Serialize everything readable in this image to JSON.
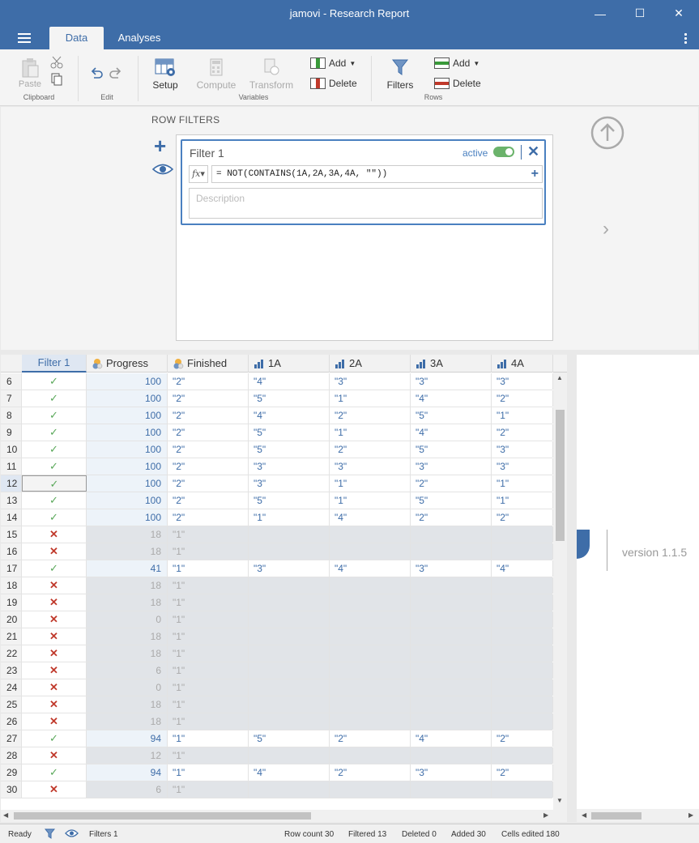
{
  "window": {
    "title": "jamovi - Research Report"
  },
  "tabs": {
    "data": "Data",
    "analyses": "Analyses"
  },
  "ribbon": {
    "paste": "Paste",
    "clipboard": "Clipboard",
    "edit": "Edit",
    "setup": "Setup",
    "compute": "Compute",
    "transform": "Transform",
    "variables": "Variables",
    "add_var": "Add",
    "delete_var": "Delete",
    "filters": "Filters",
    "add_row": "Add",
    "delete_row": "Delete",
    "rows": "Rows"
  },
  "filter_panel": {
    "title": "ROW FILTERS",
    "filter_name": "Filter 1",
    "active_label": "active",
    "formula": "= NOT(CONTAINS(1A,2A,3A,4A, \"\"))",
    "description_placeholder": "Description"
  },
  "grid": {
    "columns": [
      "Filter 1",
      "Progress",
      "Finished",
      "1A",
      "2A",
      "3A",
      "4A"
    ],
    "rows": [
      {
        "n": "6",
        "pass": true,
        "progress": "100",
        "finished": "\"2\"",
        "a1": "\"4\"",
        "a2": "\"3\"",
        "a3": "\"3\"",
        "a4": "\"3\""
      },
      {
        "n": "7",
        "pass": true,
        "progress": "100",
        "finished": "\"2\"",
        "a1": "\"5\"",
        "a2": "\"1\"",
        "a3": "\"4\"",
        "a4": "\"2\""
      },
      {
        "n": "8",
        "pass": true,
        "progress": "100",
        "finished": "\"2\"",
        "a1": "\"4\"",
        "a2": "\"2\"",
        "a3": "\"5\"",
        "a4": "\"1\""
      },
      {
        "n": "9",
        "pass": true,
        "progress": "100",
        "finished": "\"2\"",
        "a1": "\"5\"",
        "a2": "\"1\"",
        "a3": "\"4\"",
        "a4": "\"2\""
      },
      {
        "n": "10",
        "pass": true,
        "progress": "100",
        "finished": "\"2\"",
        "a1": "\"5\"",
        "a2": "\"2\"",
        "a3": "\"5\"",
        "a4": "\"3\""
      },
      {
        "n": "11",
        "pass": true,
        "progress": "100",
        "finished": "\"2\"",
        "a1": "\"3\"",
        "a2": "\"3\"",
        "a3": "\"3\"",
        "a4": "\"3\""
      },
      {
        "n": "12",
        "pass": true,
        "progress": "100",
        "finished": "\"2\"",
        "a1": "\"3\"",
        "a2": "\"1\"",
        "a3": "\"2\"",
        "a4": "\"1\"",
        "selected": true
      },
      {
        "n": "13",
        "pass": true,
        "progress": "100",
        "finished": "\"2\"",
        "a1": "\"5\"",
        "a2": "\"1\"",
        "a3": "\"5\"",
        "a4": "\"1\""
      },
      {
        "n": "14",
        "pass": true,
        "progress": "100",
        "finished": "\"2\"",
        "a1": "\"1\"",
        "a2": "\"4\"",
        "a3": "\"2\"",
        "a4": "\"2\""
      },
      {
        "n": "15",
        "pass": false,
        "progress": "18",
        "finished": "\"1\"",
        "a1": "",
        "a2": "",
        "a3": "",
        "a4": ""
      },
      {
        "n": "16",
        "pass": false,
        "progress": "18",
        "finished": "\"1\"",
        "a1": "",
        "a2": "",
        "a3": "",
        "a4": ""
      },
      {
        "n": "17",
        "pass": true,
        "progress": "41",
        "finished": "\"1\"",
        "a1": "\"3\"",
        "a2": "\"4\"",
        "a3": "\"3\"",
        "a4": "\"4\""
      },
      {
        "n": "18",
        "pass": false,
        "progress": "18",
        "finished": "\"1\"",
        "a1": "",
        "a2": "",
        "a3": "",
        "a4": ""
      },
      {
        "n": "19",
        "pass": false,
        "progress": "18",
        "finished": "\"1\"",
        "a1": "",
        "a2": "",
        "a3": "",
        "a4": ""
      },
      {
        "n": "20",
        "pass": false,
        "progress": "0",
        "finished": "\"1\"",
        "a1": "",
        "a2": "",
        "a3": "",
        "a4": ""
      },
      {
        "n": "21",
        "pass": false,
        "progress": "18",
        "finished": "\"1\"",
        "a1": "",
        "a2": "",
        "a3": "",
        "a4": ""
      },
      {
        "n": "22",
        "pass": false,
        "progress": "18",
        "finished": "\"1\"",
        "a1": "",
        "a2": "",
        "a3": "",
        "a4": ""
      },
      {
        "n": "23",
        "pass": false,
        "progress": "6",
        "finished": "\"1\"",
        "a1": "",
        "a2": "",
        "a3": "",
        "a4": ""
      },
      {
        "n": "24",
        "pass": false,
        "progress": "0",
        "finished": "\"1\"",
        "a1": "",
        "a2": "",
        "a3": "",
        "a4": ""
      },
      {
        "n": "25",
        "pass": false,
        "progress": "18",
        "finished": "\"1\"",
        "a1": "",
        "a2": "",
        "a3": "",
        "a4": ""
      },
      {
        "n": "26",
        "pass": false,
        "progress": "18",
        "finished": "\"1\"",
        "a1": "",
        "a2": "",
        "a3": "",
        "a4": ""
      },
      {
        "n": "27",
        "pass": true,
        "progress": "94",
        "finished": "\"1\"",
        "a1": "\"5\"",
        "a2": "\"2\"",
        "a3": "\"4\"",
        "a4": "\"2\""
      },
      {
        "n": "28",
        "pass": false,
        "progress": "12",
        "finished": "\"1\"",
        "a1": "",
        "a2": "",
        "a3": "",
        "a4": ""
      },
      {
        "n": "29",
        "pass": true,
        "progress": "94",
        "finished": "\"1\"",
        "a1": "\"4\"",
        "a2": "\"2\"",
        "a3": "\"3\"",
        "a4": "\"2\""
      },
      {
        "n": "30",
        "pass": false,
        "progress": "6",
        "finished": "\"1\"",
        "a1": "",
        "a2": "",
        "a3": "",
        "a4": ""
      }
    ]
  },
  "results": {
    "version": "version 1.1.5"
  },
  "status": {
    "ready": "Ready",
    "filters": "Filters 1",
    "row_count": "Row count 30",
    "filtered": "Filtered 13",
    "deleted": "Deleted 0",
    "added": "Added 30",
    "cells_edited": "Cells edited 180"
  },
  "colors": {
    "accent": "#3e6da8",
    "pass": "#5aa85a",
    "fail": "#c0392b"
  }
}
